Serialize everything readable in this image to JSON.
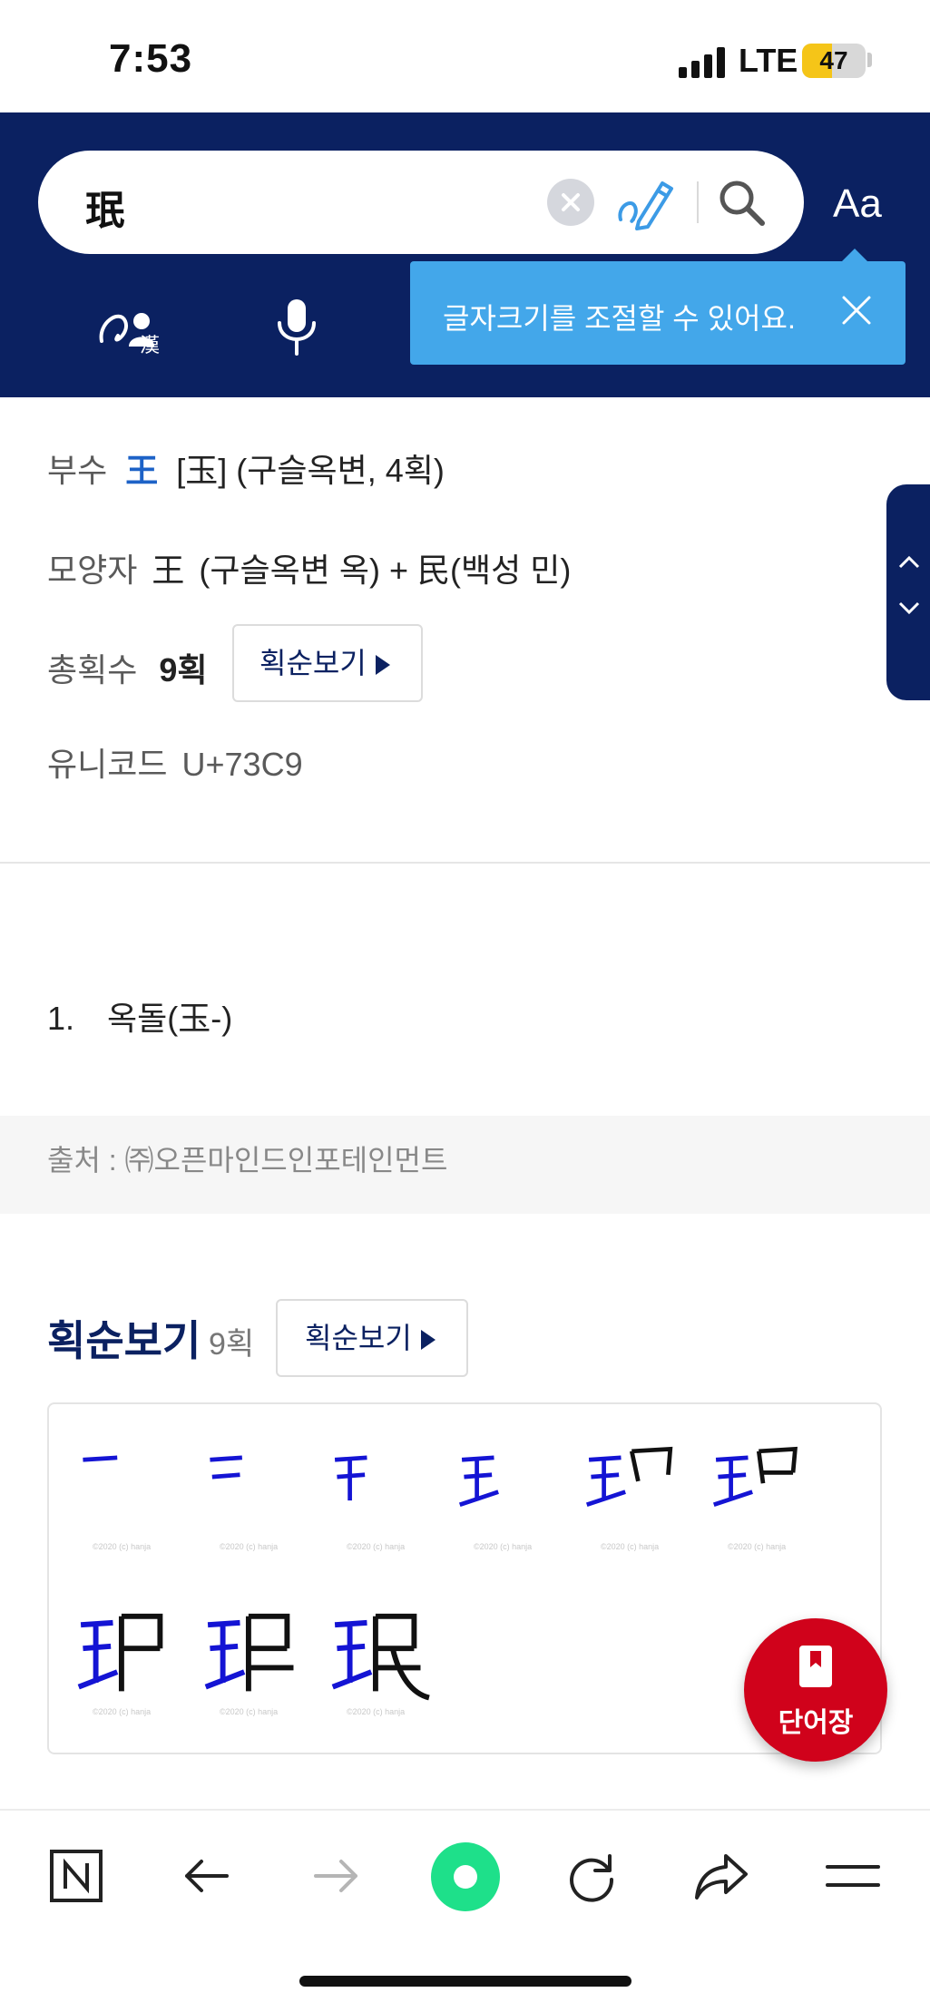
{
  "status_bar": {
    "time": "7:53",
    "network": "LTE",
    "battery": "47",
    "battery_level": 0.47
  },
  "search": {
    "query": "珉"
  },
  "header": {
    "font_size_button": "Aa",
    "tooltip": "글자크기를 조절할 수 있어요."
  },
  "character_info": {
    "radical_label": "부수",
    "radical_glyph": "王",
    "radical_detail": "[玉] (구슬옥변, 4획)",
    "shape_label": "모양자",
    "shape_glyph": "王",
    "shape_detail": "(구슬옥변 옥) + 民(백성 민)",
    "strokes_label": "총획수",
    "strokes_value": "9획",
    "stroke_order_button": "획순보기",
    "unicode_label": "유니코드",
    "unicode_value": "U+73C9"
  },
  "meanings": [
    {
      "number": "1.",
      "text": "옥돌(玉-)"
    }
  ],
  "source": "출처 : ㈜오픈마인드인포테인먼트",
  "stroke_order": {
    "title": "획순보기",
    "count": "9획",
    "button": "획순보기",
    "watermark": "©2020 (c) hanja"
  },
  "fab": {
    "label": "단어장"
  },
  "colors": {
    "header_bg": "#0b2161",
    "tooltip_bg": "#43a7ea",
    "fab_bg": "#d0021b",
    "accent_green": "#1ee08a"
  },
  "icons": [
    "search-icon",
    "clear-icon",
    "handwriting-pen-icon",
    "handwriting-hanja-icon",
    "microphone-icon",
    "close-icon",
    "chevron-up-icon",
    "chevron-down-icon",
    "bookmark-icon",
    "naver-n-icon",
    "back-arrow-icon",
    "forward-arrow-icon",
    "green-dot-icon",
    "refresh-icon",
    "share-icon",
    "menu-icon"
  ]
}
